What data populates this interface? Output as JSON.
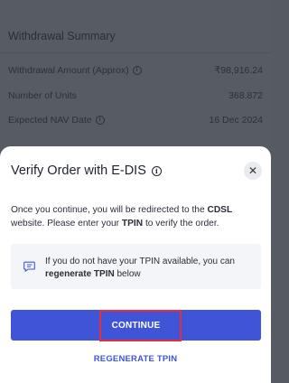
{
  "summary": {
    "title": "Withdrawal Summary",
    "rows": [
      {
        "label": "Withdrawal Amount (Approx)",
        "value": "₹98,916.24",
        "has_info": true
      },
      {
        "label": "Number of Units",
        "value": "368.872",
        "has_info": false
      },
      {
        "label": "Expected NAV Date",
        "value": "16 Dec 2024",
        "has_info": true
      }
    ]
  },
  "sheet": {
    "title": "Verify Order with E-DIS",
    "description": {
      "part1": "Once you continue, you will be redirected to the ",
      "bold1": "CDSL",
      "part2": " website. Please enter your ",
      "bold2": "TPIN",
      "part3": " to verify the order."
    },
    "notice": {
      "part1": "If you do not have your TPIN available, you can ",
      "bold": "regenerate TPIN",
      "part2": " below"
    },
    "continue_label": "CONTINUE",
    "regenerate_label": "REGENERATE TPIN"
  },
  "colors": {
    "primary": "#3f54d6",
    "highlight": "#e0313c",
    "backdrop": "#565b64"
  },
  "icons": [
    "info-icon",
    "close-icon",
    "message-icon"
  ]
}
